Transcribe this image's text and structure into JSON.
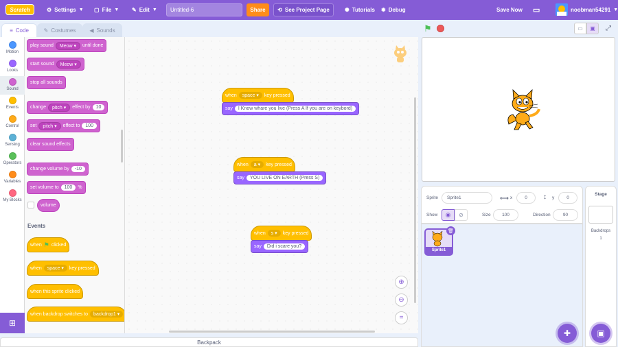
{
  "menubar": {
    "logo": "Scratch",
    "settings": "Settings",
    "file": "File",
    "edit": "Edit",
    "project_title": "Untitled-6",
    "share": "Share",
    "see_project": "See Project Page",
    "tutorials": "Tutorials",
    "debug": "Debug",
    "save_now": "Save Now",
    "username": "noobman54291"
  },
  "tabs": {
    "code": "Code",
    "costumes": "Costumes",
    "sounds": "Sounds"
  },
  "categories": [
    {
      "label": "Motion",
      "color": "#4c97ff"
    },
    {
      "label": "Looks",
      "color": "#9966ff"
    },
    {
      "label": "Sound",
      "color": "#cf63cf"
    },
    {
      "label": "Events",
      "color": "#ffbf00"
    },
    {
      "label": "Control",
      "color": "#ffab19"
    },
    {
      "label": "Sensing",
      "color": "#5cb1d6"
    },
    {
      "label": "Operators",
      "color": "#59c059"
    },
    {
      "label": "Variables",
      "color": "#ff8c1a"
    },
    {
      "label": "My Blocks",
      "color": "#ff6680"
    }
  ],
  "palette": {
    "play_sound": "play sound",
    "play_sound_val": "Meow",
    "until_done": "until done",
    "start_sound": "start sound",
    "start_sound_val": "Meow",
    "stop_all_sounds": "stop all sounds",
    "change": "change",
    "pitch": "pitch",
    "effect_by": "effect by",
    "effect_by_val": "10",
    "set": "set",
    "effect_to": "effect to",
    "effect_to_val": "100",
    "clear_sound_effects": "clear sound effects",
    "change_volume_by": "change volume by",
    "change_volume_val": "-10",
    "set_volume_to": "set volume to",
    "set_volume_val": "100",
    "percent": "%",
    "volume": "volume",
    "events_title": "Events",
    "when": "when",
    "clicked": "clicked",
    "space": "space",
    "key_pressed": "key pressed",
    "when_sprite_clicked": "when this sprite clicked",
    "when_backdrop": "when backdrop switches to",
    "backdrop1": "backdrop1"
  },
  "scripts": [
    {
      "when": "when",
      "key": "space",
      "key_pressed": "key pressed",
      "say": "say",
      "text": "I Know whare you live (Press A If you are on keybord)"
    },
    {
      "when": "when",
      "key": "a",
      "key_pressed": "key pressed",
      "say": "say",
      "text": "YOU LIVE ON EARTH (Press S)"
    },
    {
      "when": "when",
      "key": "s",
      "key_pressed": "key pressed",
      "say": "say",
      "text": "Did i scare you?"
    }
  ],
  "backpack": "Backpack",
  "sprite_info": {
    "sprite_label": "Sprite",
    "sprite_name": "Sprite1",
    "x_label": "x",
    "x_val": "0",
    "y_label": "y",
    "y_val": "0",
    "show_label": "Show",
    "size_label": "Size",
    "size_val": "100",
    "direction_label": "Direction",
    "direction_val": "90"
  },
  "sprite_thumb": "Sprite1",
  "stage_panel": {
    "title": "Stage",
    "backdrops_label": "Backdrops",
    "backdrops_count": "1"
  }
}
